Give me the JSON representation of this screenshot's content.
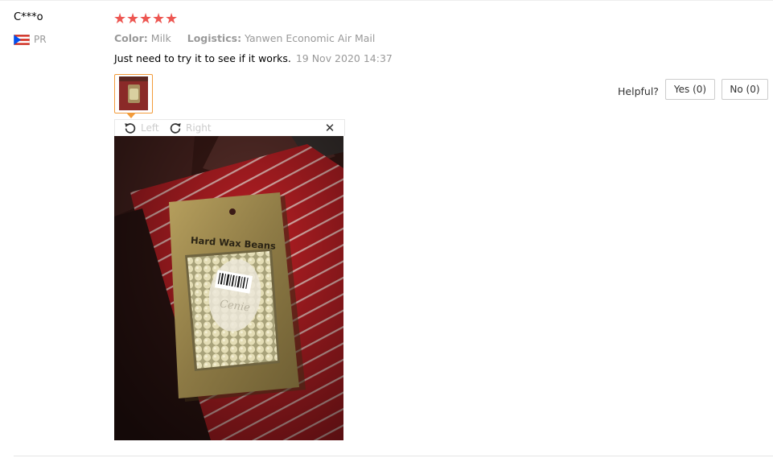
{
  "review": {
    "user_name": "C***o",
    "country_code": "PR",
    "rating": 5,
    "star_glyph": "★",
    "star_color": "#ed5651",
    "color_label": "Color:",
    "color_value": "Milk",
    "logistics_label": "Logistics:",
    "logistics_value": "Yanwen Economic Air Mail",
    "text": "Just need to try it to see if it works.",
    "date": "19 Nov 2020 14:37"
  },
  "viewer": {
    "rotate_left_label": "Left",
    "rotate_right_label": "Right",
    "close_glyph": "✕",
    "photo_text": {
      "bag_label": "Hard Wax Beans",
      "sticker_text": "Cenie"
    }
  },
  "helpful": {
    "label": "Helpful?",
    "yes_label": "Yes (0)",
    "no_label": "No (0)"
  },
  "colors": {
    "accent_orange": "#f29b3a",
    "muted_text": "#999999",
    "disabled_text": "#cccccc"
  },
  "icons": {
    "flag": "puerto-rico-flag-icon",
    "rotate_left": "rotate-left-icon",
    "rotate_right": "rotate-right-icon",
    "close": "close-icon",
    "star": "star-icon"
  }
}
